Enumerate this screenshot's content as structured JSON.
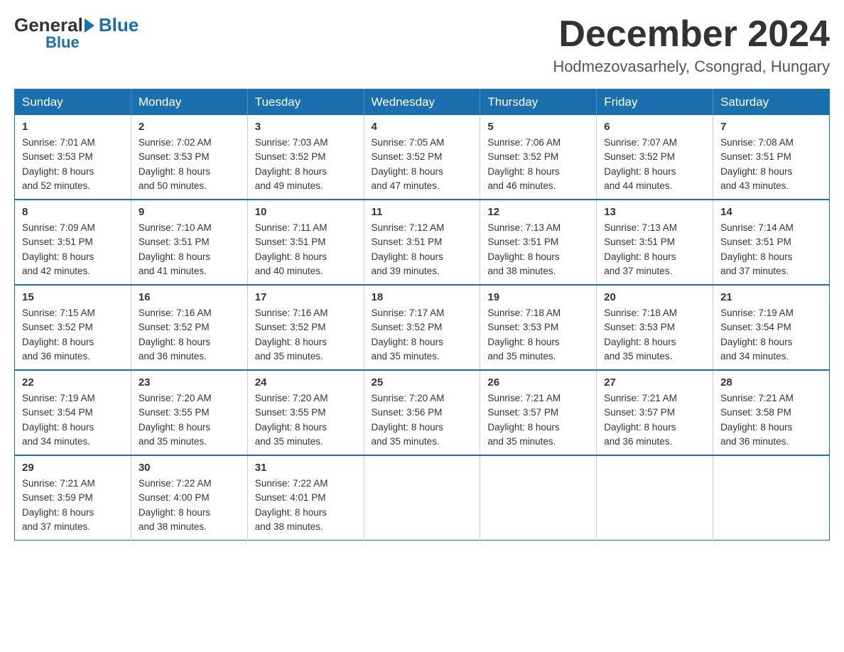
{
  "logo": {
    "general": "General",
    "blue": "Blue"
  },
  "title": {
    "month": "December 2024",
    "location": "Hodmezovasarhely, Csongrad, Hungary"
  },
  "days_of_week": [
    "Sunday",
    "Monday",
    "Tuesday",
    "Wednesday",
    "Thursday",
    "Friday",
    "Saturday"
  ],
  "weeks": [
    [
      {
        "day": "1",
        "sunrise": "7:01 AM",
        "sunset": "3:53 PM",
        "daylight": "8 hours and 52 minutes."
      },
      {
        "day": "2",
        "sunrise": "7:02 AM",
        "sunset": "3:53 PM",
        "daylight": "8 hours and 50 minutes."
      },
      {
        "day": "3",
        "sunrise": "7:03 AM",
        "sunset": "3:52 PM",
        "daylight": "8 hours and 49 minutes."
      },
      {
        "day": "4",
        "sunrise": "7:05 AM",
        "sunset": "3:52 PM",
        "daylight": "8 hours and 47 minutes."
      },
      {
        "day": "5",
        "sunrise": "7:06 AM",
        "sunset": "3:52 PM",
        "daylight": "8 hours and 46 minutes."
      },
      {
        "day": "6",
        "sunrise": "7:07 AM",
        "sunset": "3:52 PM",
        "daylight": "8 hours and 44 minutes."
      },
      {
        "day": "7",
        "sunrise": "7:08 AM",
        "sunset": "3:51 PM",
        "daylight": "8 hours and 43 minutes."
      }
    ],
    [
      {
        "day": "8",
        "sunrise": "7:09 AM",
        "sunset": "3:51 PM",
        "daylight": "8 hours and 42 minutes."
      },
      {
        "day": "9",
        "sunrise": "7:10 AM",
        "sunset": "3:51 PM",
        "daylight": "8 hours and 41 minutes."
      },
      {
        "day": "10",
        "sunrise": "7:11 AM",
        "sunset": "3:51 PM",
        "daylight": "8 hours and 40 minutes."
      },
      {
        "day": "11",
        "sunrise": "7:12 AM",
        "sunset": "3:51 PM",
        "daylight": "8 hours and 39 minutes."
      },
      {
        "day": "12",
        "sunrise": "7:13 AM",
        "sunset": "3:51 PM",
        "daylight": "8 hours and 38 minutes."
      },
      {
        "day": "13",
        "sunrise": "7:13 AM",
        "sunset": "3:51 PM",
        "daylight": "8 hours and 37 minutes."
      },
      {
        "day": "14",
        "sunrise": "7:14 AM",
        "sunset": "3:51 PM",
        "daylight": "8 hours and 37 minutes."
      }
    ],
    [
      {
        "day": "15",
        "sunrise": "7:15 AM",
        "sunset": "3:52 PM",
        "daylight": "8 hours and 36 minutes."
      },
      {
        "day": "16",
        "sunrise": "7:16 AM",
        "sunset": "3:52 PM",
        "daylight": "8 hours and 36 minutes."
      },
      {
        "day": "17",
        "sunrise": "7:16 AM",
        "sunset": "3:52 PM",
        "daylight": "8 hours and 35 minutes."
      },
      {
        "day": "18",
        "sunrise": "7:17 AM",
        "sunset": "3:52 PM",
        "daylight": "8 hours and 35 minutes."
      },
      {
        "day": "19",
        "sunrise": "7:18 AM",
        "sunset": "3:53 PM",
        "daylight": "8 hours and 35 minutes."
      },
      {
        "day": "20",
        "sunrise": "7:18 AM",
        "sunset": "3:53 PM",
        "daylight": "8 hours and 35 minutes."
      },
      {
        "day": "21",
        "sunrise": "7:19 AM",
        "sunset": "3:54 PM",
        "daylight": "8 hours and 34 minutes."
      }
    ],
    [
      {
        "day": "22",
        "sunrise": "7:19 AM",
        "sunset": "3:54 PM",
        "daylight": "8 hours and 34 minutes."
      },
      {
        "day": "23",
        "sunrise": "7:20 AM",
        "sunset": "3:55 PM",
        "daylight": "8 hours and 35 minutes."
      },
      {
        "day": "24",
        "sunrise": "7:20 AM",
        "sunset": "3:55 PM",
        "daylight": "8 hours and 35 minutes."
      },
      {
        "day": "25",
        "sunrise": "7:20 AM",
        "sunset": "3:56 PM",
        "daylight": "8 hours and 35 minutes."
      },
      {
        "day": "26",
        "sunrise": "7:21 AM",
        "sunset": "3:57 PM",
        "daylight": "8 hours and 35 minutes."
      },
      {
        "day": "27",
        "sunrise": "7:21 AM",
        "sunset": "3:57 PM",
        "daylight": "8 hours and 36 minutes."
      },
      {
        "day": "28",
        "sunrise": "7:21 AM",
        "sunset": "3:58 PM",
        "daylight": "8 hours and 36 minutes."
      }
    ],
    [
      {
        "day": "29",
        "sunrise": "7:21 AM",
        "sunset": "3:59 PM",
        "daylight": "8 hours and 37 minutes."
      },
      {
        "day": "30",
        "sunrise": "7:22 AM",
        "sunset": "4:00 PM",
        "daylight": "8 hours and 38 minutes."
      },
      {
        "day": "31",
        "sunrise": "7:22 AM",
        "sunset": "4:01 PM",
        "daylight": "8 hours and 38 minutes."
      },
      null,
      null,
      null,
      null
    ]
  ],
  "labels": {
    "sunrise": "Sunrise:",
    "sunset": "Sunset:",
    "daylight": "Daylight:"
  }
}
